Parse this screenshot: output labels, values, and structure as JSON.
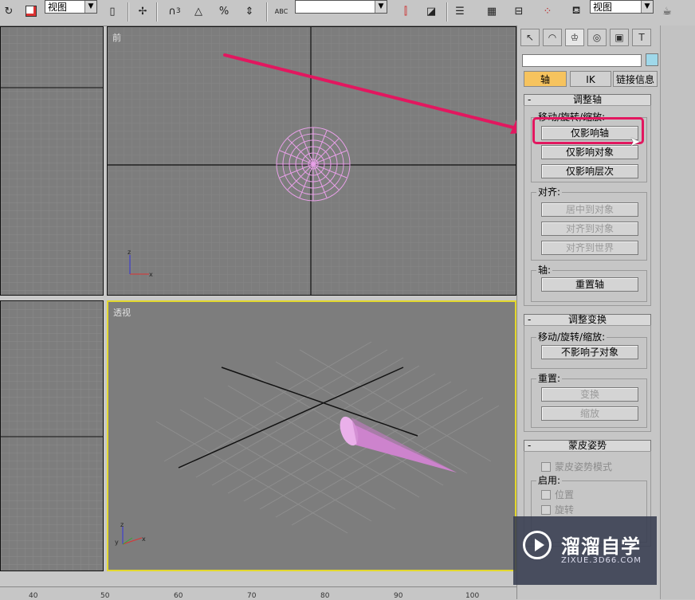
{
  "toolbar": {
    "view_dropdown_1": "视图",
    "view_dropdown_2": "视图",
    "snap_3_label": "3",
    "snap_abc_label": "ABC"
  },
  "viewports": {
    "front_label": "前",
    "perspective_label": "透视",
    "front_axis_x": "x",
    "front_axis_z": "z",
    "persp_axis_x": "x",
    "persp_axis_y": "y",
    "persp_axis_z": "z",
    "active_border_color": "#e3d82e",
    "object_color": "#e8a0e8"
  },
  "panel": {
    "subtabs": [
      "轴",
      "IK",
      "链接信息"
    ],
    "rollout_adjust_pivot": {
      "title": "调整轴",
      "group_move": "移动/旋转/缩放:",
      "btn_affect_pivot": "仅影响轴",
      "btn_affect_object": "仅影响对象",
      "btn_affect_hierarchy": "仅影响层次",
      "group_align": "对齐:",
      "btn_center": "居中到对象",
      "btn_align_obj": "对齐到对象",
      "btn_align_world": "对齐到世界",
      "group_pivot": "轴:",
      "btn_reset_pivot": "重置轴"
    },
    "rollout_adjust_transform": {
      "title": "调整变换",
      "group_move": "移动/旋转/缩放:",
      "btn_dont_affect_children": "不影响子对象",
      "group_reset": "重置:",
      "btn_transform": "变换",
      "btn_scale": "缩放"
    },
    "rollout_skin_pose": {
      "title": "蒙皮姿势",
      "chk_skin_pose_mode": "蒙皮姿势模式",
      "group_enable": "启用:",
      "chk_position": "位置",
      "chk_rotation": "旋转"
    },
    "highlight_color": "#e2175f"
  },
  "watermark": {
    "title": "溜溜自学",
    "subtitle": "ZIXUE.3D66.COM"
  },
  "timeline": {
    "ticks": [
      "40",
      "50",
      "60",
      "70",
      "80",
      "90",
      "100"
    ]
  }
}
